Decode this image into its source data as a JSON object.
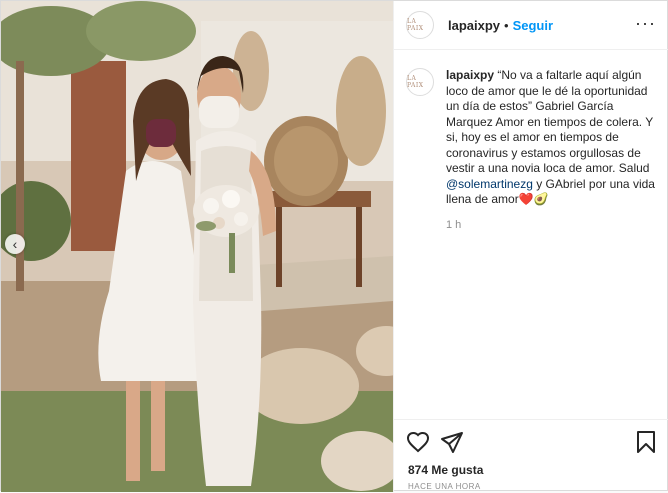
{
  "account": {
    "username": "lapaixpy",
    "avatar_text": "LA PAIX",
    "follow_label": "Seguir",
    "separator": "•"
  },
  "caption": {
    "username": "lapaixpy",
    "text_part1": "“No va a faltarle aquí algún loco de amor que le dé la oportunidad un día de estos” Gabriel García Marquez Amor en tiempos de colera. Y si, hoy es el amor en tiempos de coronavirus y estamos orgullosas de vestir a una novia loca de amor. Salud ",
    "mention": "@solemartinezg",
    "text_part2": " y GAbriel por una vida llena de amor",
    "emoji": "❤️🥑",
    "time": "1 h"
  },
  "actions": {
    "likes": "874 Me gusta",
    "posted_ago": "HACE UNA HORA",
    "icons": [
      "heart-icon",
      "share-icon",
      "bookmark-icon",
      "carousel-prev-icon",
      "more-options-icon"
    ]
  },
  "colors": {
    "accent": "#0095f6",
    "mention": "#00376b",
    "muted": "#8e8e8e"
  }
}
